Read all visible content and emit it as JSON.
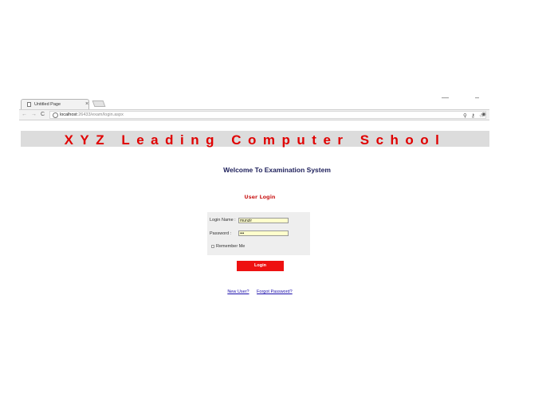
{
  "browser": {
    "tab_title": "Untitled Page",
    "tab_close": "×",
    "window_minimize": "—",
    "window_maximize": "–",
    "nav_back": "←",
    "nav_forward": "→",
    "reload": "C",
    "url_host": "localhost",
    "url_rest": ":26433/exam/login.aspx",
    "zoom_icon": "search-icon",
    "key_icon": "key-icon",
    "star_icon": "star-icon",
    "extension_icon": "extension-icon"
  },
  "page": {
    "banner": "XYZ Leading Computer School",
    "welcome": "Welcome To Examination System",
    "section_title": "User Login",
    "form": {
      "login_name_label": "Login Name :",
      "login_name_value": "munzir",
      "password_label": "Password :",
      "password_value": "•••",
      "remember_me_label": "Remember Me",
      "remember_me_checked": false,
      "field_color": "#ffffcc"
    },
    "login_button": "Login",
    "new_user_link": "New User?",
    "forgot_password_link": "Forgot Password?",
    "accent_color": "#e00000"
  }
}
